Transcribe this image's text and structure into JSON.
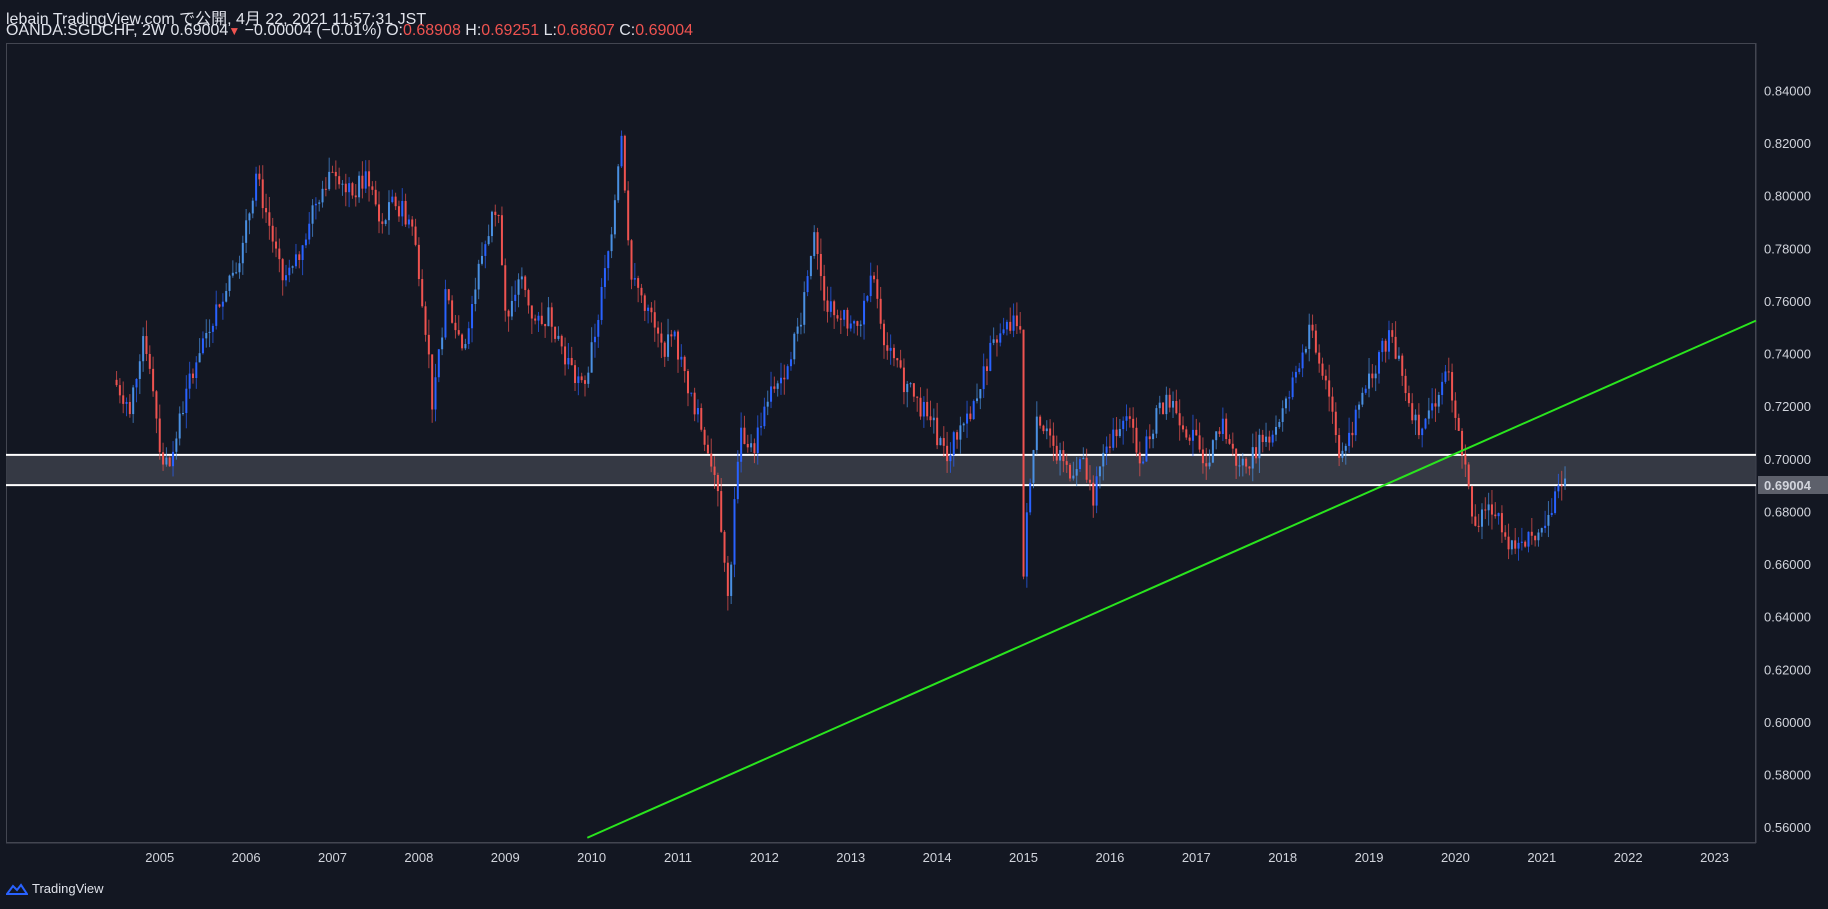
{
  "header": {
    "published": "lebain TradingView.com で公開, 4月 22, 2021 11:57:31 JST",
    "symbol": "OANDA:SGDCHF, 2W",
    "last": "0.69004",
    "change": "−0.00004 (−0.01%)",
    "o_label": "O:",
    "o_value": "0.68908",
    "h_label": "H:",
    "h_value": "0.69251",
    "l_label": "L:",
    "l_value": "0.68607",
    "c_label": "C:",
    "c_value": "0.69004"
  },
  "footer": {
    "brand": "TradingView",
    "logo_icon": "tradingview-logo-icon"
  },
  "colors": {
    "background": "#131722",
    "up": "#2962ff",
    "up_light": "#4a90e2",
    "down": "#ef5350",
    "trendline": "#2ae51e",
    "zone_fill": "#3a3d48",
    "zone_lines": "#ffffff",
    "price_tag_bg": "#5d606b"
  },
  "chart_data": {
    "type": "candlestick",
    "title": "",
    "ylim": [
      0.554,
      0.858
    ],
    "xlim": [
      2003.22,
      2023.48
    ],
    "y_ticks": [
      "0.56000",
      "0.58000",
      "0.60000",
      "0.62000",
      "0.64000",
      "0.66000",
      "0.68000",
      "0.70000",
      "0.72000",
      "0.74000",
      "0.76000",
      "0.78000",
      "0.80000",
      "0.82000",
      "0.84000"
    ],
    "x_ticks": [
      "2005",
      "2006",
      "2007",
      "2008",
      "2009",
      "2010",
      "2011",
      "2012",
      "2013",
      "2014",
      "2015",
      "2016",
      "2017",
      "2018",
      "2019",
      "2020",
      "2021",
      "2022",
      "2023"
    ],
    "last_price_label": "0.69004",
    "last_price": 0.69004,
    "price_path": [
      [
        2004.5,
        0.73
      ],
      [
        2004.7,
        0.72
      ],
      [
        2004.85,
        0.748
      ],
      [
        2004.95,
        0.732
      ],
      [
        2005.05,
        0.701
      ],
      [
        2005.15,
        0.697
      ],
      [
        2005.25,
        0.712
      ],
      [
        2005.45,
        0.738
      ],
      [
        2005.7,
        0.758
      ],
      [
        2005.85,
        0.77
      ],
      [
        2006.0,
        0.78
      ],
      [
        2006.15,
        0.808
      ],
      [
        2006.3,
        0.79
      ],
      [
        2006.45,
        0.768
      ],
      [
        2006.6,
        0.772
      ],
      [
        2006.8,
        0.795
      ],
      [
        2007.05,
        0.812
      ],
      [
        2007.25,
        0.8
      ],
      [
        2007.45,
        0.808
      ],
      [
        2007.6,
        0.788
      ],
      [
        2007.75,
        0.798
      ],
      [
        2007.95,
        0.79
      ],
      [
        2008.05,
        0.77
      ],
      [
        2008.15,
        0.74
      ],
      [
        2008.2,
        0.718
      ],
      [
        2008.35,
        0.762
      ],
      [
        2008.55,
        0.742
      ],
      [
        2008.75,
        0.775
      ],
      [
        2008.95,
        0.8
      ],
      [
        2009.05,
        0.748
      ],
      [
        2009.2,
        0.77
      ],
      [
        2009.4,
        0.75
      ],
      [
        2009.55,
        0.755
      ],
      [
        2009.75,
        0.738
      ],
      [
        2009.95,
        0.725
      ],
      [
        2010.1,
        0.752
      ],
      [
        2010.25,
        0.782
      ],
      [
        2010.38,
        0.825
      ],
      [
        2010.5,
        0.768
      ],
      [
        2010.65,
        0.76
      ],
      [
        2010.85,
        0.742
      ],
      [
        2011.0,
        0.745
      ],
      [
        2011.15,
        0.728
      ],
      [
        2011.35,
        0.708
      ],
      [
        2011.5,
        0.69
      ],
      [
        2011.62,
        0.645
      ],
      [
        2011.75,
        0.712
      ],
      [
        2011.9,
        0.702
      ],
      [
        2012.05,
        0.722
      ],
      [
        2012.25,
        0.732
      ],
      [
        2012.45,
        0.752
      ],
      [
        2012.6,
        0.785
      ],
      [
        2012.75,
        0.76
      ],
      [
        2012.9,
        0.755
      ],
      [
        2013.1,
        0.748
      ],
      [
        2013.3,
        0.77
      ],
      [
        2013.45,
        0.742
      ],
      [
        2013.6,
        0.732
      ],
      [
        2013.8,
        0.722
      ],
      [
        2014.0,
        0.712
      ],
      [
        2014.15,
        0.7
      ],
      [
        2014.3,
        0.712
      ],
      [
        2014.45,
        0.72
      ],
      [
        2014.65,
        0.74
      ],
      [
        2014.85,
        0.75
      ],
      [
        2015.0,
        0.752
      ],
      [
        2015.02,
        0.645
      ],
      [
        2015.1,
        0.69
      ],
      [
        2015.2,
        0.718
      ],
      [
        2015.35,
        0.705
      ],
      [
        2015.55,
        0.695
      ],
      [
        2015.7,
        0.7
      ],
      [
        2015.85,
        0.685
      ],
      [
        2016.0,
        0.705
      ],
      [
        2016.2,
        0.718
      ],
      [
        2016.4,
        0.7
      ],
      [
        2016.6,
        0.718
      ],
      [
        2016.75,
        0.722
      ],
      [
        2016.95,
        0.71
      ],
      [
        2017.15,
        0.7
      ],
      [
        2017.35,
        0.712
      ],
      [
        2017.55,
        0.695
      ],
      [
        2017.75,
        0.705
      ],
      [
        2017.95,
        0.712
      ],
      [
        2018.1,
        0.722
      ],
      [
        2018.25,
        0.74
      ],
      [
        2018.35,
        0.748
      ],
      [
        2018.55,
        0.73
      ],
      [
        2018.7,
        0.702
      ],
      [
        2018.85,
        0.712
      ],
      [
        2019.0,
        0.728
      ],
      [
        2019.2,
        0.742
      ],
      [
        2019.3,
        0.748
      ],
      [
        2019.45,
        0.728
      ],
      [
        2019.6,
        0.712
      ],
      [
        2019.8,
        0.722
      ],
      [
        2019.95,
        0.732
      ],
      [
        2020.05,
        0.712
      ],
      [
        2020.15,
        0.7
      ],
      [
        2020.25,
        0.67
      ],
      [
        2020.4,
        0.685
      ],
      [
        2020.55,
        0.678
      ],
      [
        2020.7,
        0.665
      ],
      [
        2020.85,
        0.67
      ],
      [
        2021.0,
        0.668
      ],
      [
        2021.15,
        0.678
      ],
      [
        2021.25,
        0.694
      ],
      [
        2021.3,
        0.69
      ]
    ],
    "annotations": {
      "support_zone": {
        "top": 0.7015,
        "bottom": 0.69
      },
      "trendline": {
        "from": [
          2009.95,
          0.556
        ],
        "to": [
          2023.48,
          0.7525
        ]
      }
    }
  }
}
